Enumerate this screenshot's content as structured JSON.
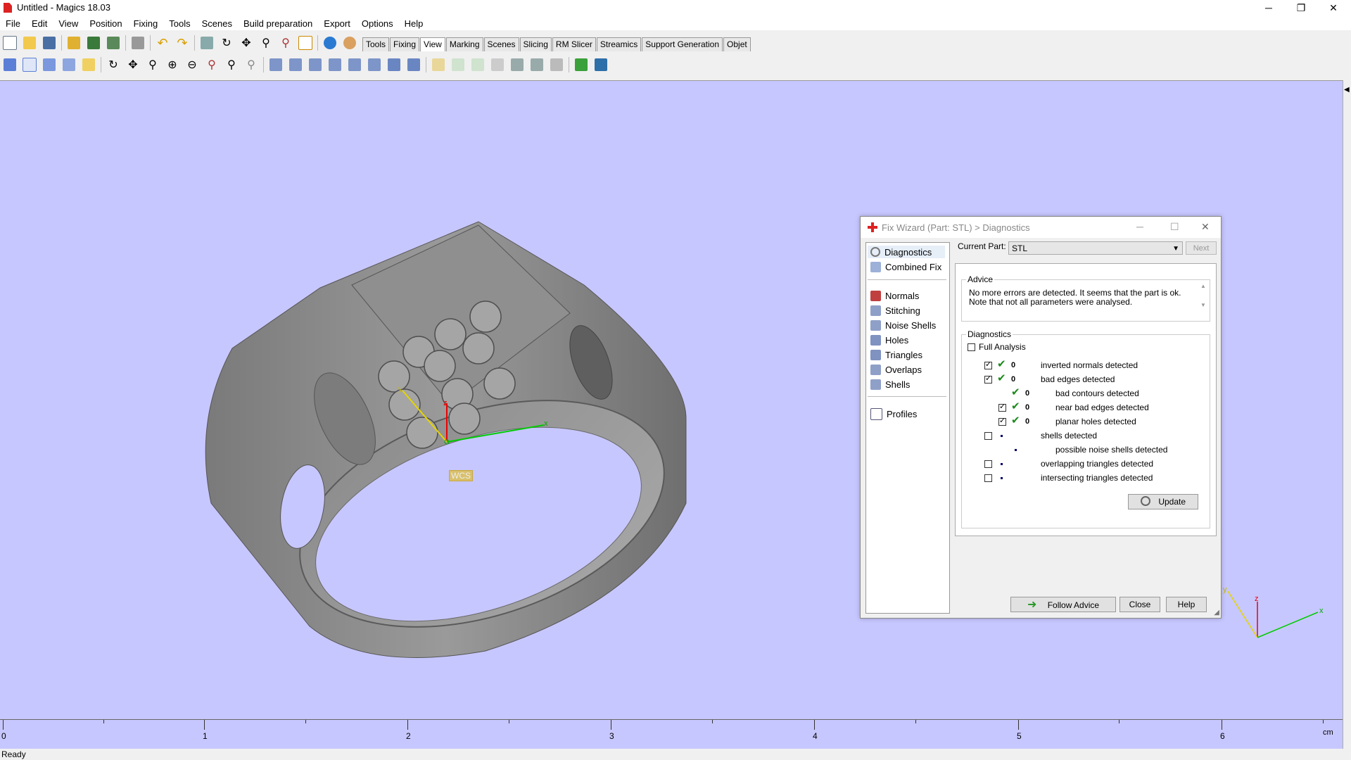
{
  "window": {
    "title": "Untitled - Magics 18.03",
    "minimize": "─",
    "restore": "❐",
    "close": "✕"
  },
  "menu": [
    "File",
    "Edit",
    "View",
    "Position",
    "Fixing",
    "Tools",
    "Scenes",
    "Build preparation",
    "Export",
    "Options",
    "Help"
  ],
  "toolbar_tabs": [
    "Tools",
    "Fixing",
    "View",
    "Marking",
    "Scenes",
    "Slicing",
    "RM Slicer",
    "Streamics",
    "Support Generation",
    "Objet"
  ],
  "active_tab": "View",
  "viewport": {
    "wcs_label": "WCS",
    "axis_x": "x",
    "axis_y": "y",
    "axis_z": "z",
    "bg_color": "#c7c7ff"
  },
  "ruler": {
    "labels": [
      "0",
      "1",
      "2",
      "3",
      "4",
      "5",
      "6"
    ],
    "unit": "cm"
  },
  "status": "Ready",
  "dialog": {
    "title": "Fix Wizard (Part: STL) > Diagnostics",
    "nav_top": [
      "Diagnostics",
      "Combined Fix"
    ],
    "nav_tools": [
      "Normals",
      "Stitching",
      "Noise Shells",
      "Holes",
      "Triangles",
      "Overlaps",
      "Shells"
    ],
    "nav_bottom": [
      "Profiles"
    ],
    "current_part_label": "Current Part:",
    "current_part_value": "STL",
    "next_label": "Next",
    "advice_title": "Advice",
    "advice_text": "No more errors are detected. It seems that the part is ok. Note that not all parameters were analysed.",
    "diagnostics_title": "Diagnostics",
    "full_analysis_label": "Full Analysis",
    "rows": {
      "inverted_normals": {
        "label": "inverted normals detected",
        "value": "0"
      },
      "bad_edges": {
        "label": "bad edges detected",
        "value": "0"
      },
      "bad_contours": {
        "label": "bad contours detected",
        "value": "0"
      },
      "near_bad_edges": {
        "label": "near bad edges detected",
        "value": "0"
      },
      "planar_holes": {
        "label": "planar holes detected",
        "value": "0"
      },
      "shells": {
        "label": "shells detected"
      },
      "noise_shells": {
        "label": "possible noise shells detected"
      },
      "overlapping": {
        "label": "overlapping triangles detected"
      },
      "intersecting": {
        "label": "intersecting triangles detected"
      }
    },
    "update_label": "Update",
    "follow_advice_label": "Follow Advice",
    "close_label": "Close",
    "help_label": "Help"
  }
}
